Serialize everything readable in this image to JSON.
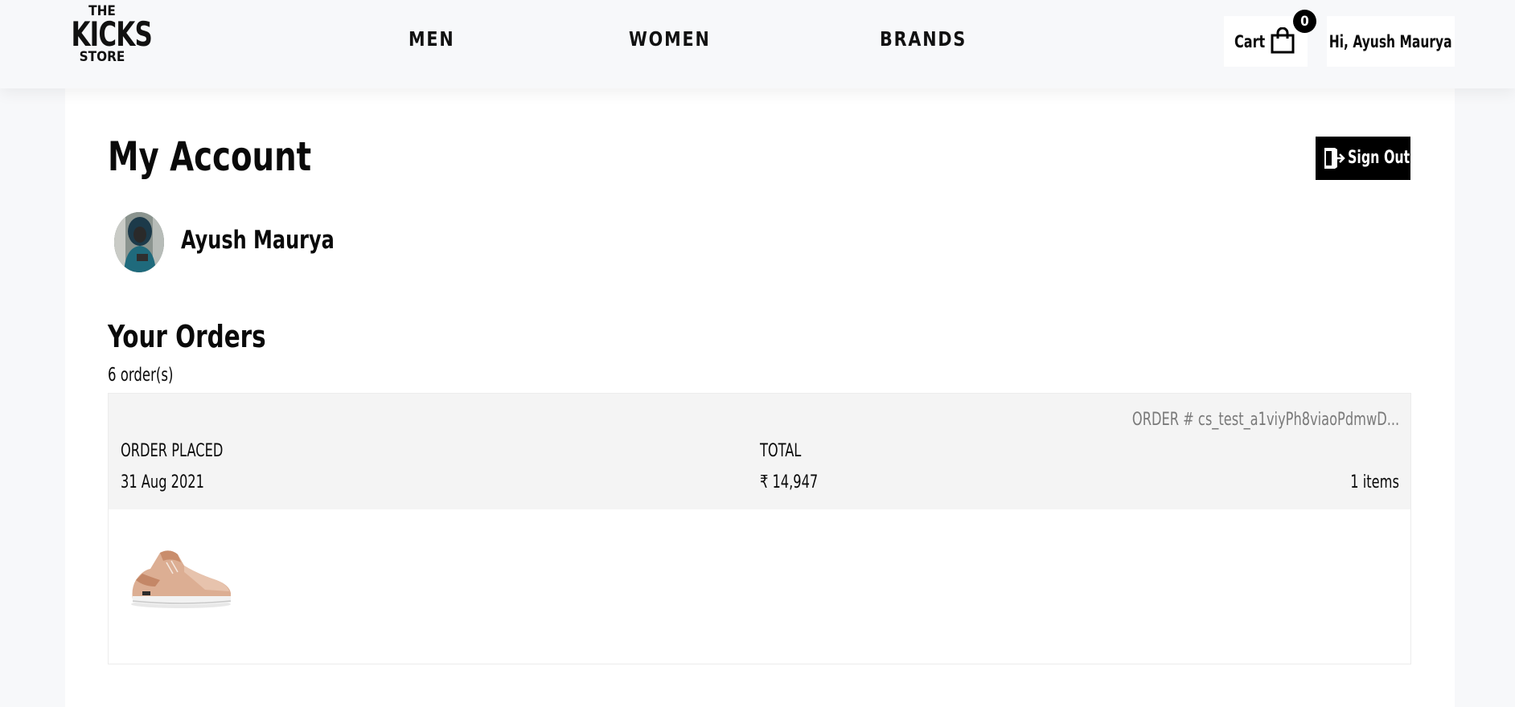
{
  "header": {
    "logo": {
      "line1": "THE",
      "line2": "KICKS",
      "line3": "STORE"
    },
    "nav": [
      {
        "label": "MEN"
      },
      {
        "label": "WOMEN"
      },
      {
        "label": "BRANDS"
      }
    ],
    "cart": {
      "label": "Cart",
      "count": "0",
      "icon": "shopping-bag-icon"
    },
    "user_greeting": "Hi, Ayush Maurya"
  },
  "account": {
    "title": "My Account",
    "sign_out_label": "Sign Out",
    "sign_out_icon": "sign-out-icon",
    "user_name": "Ayush Maurya"
  },
  "orders": {
    "title": "Your Orders",
    "count_text": "6 order(s)",
    "list": [
      {
        "order_number": "ORDER # cs_test_a1viyPh8viaoPdmwD...",
        "placed_label": "ORDER PLACED",
        "placed_date": "31 Aug 2021",
        "total_label": "TOTAL",
        "total_value": "₹ 14,947",
        "items_text": "1 items"
      }
    ]
  },
  "colors": {
    "page_bg": "#f7f8fa",
    "card_bg": "#ffffff",
    "accent": "#000000",
    "order_header_bg": "#f4f4f4",
    "muted_text": "#7a7a7a"
  }
}
